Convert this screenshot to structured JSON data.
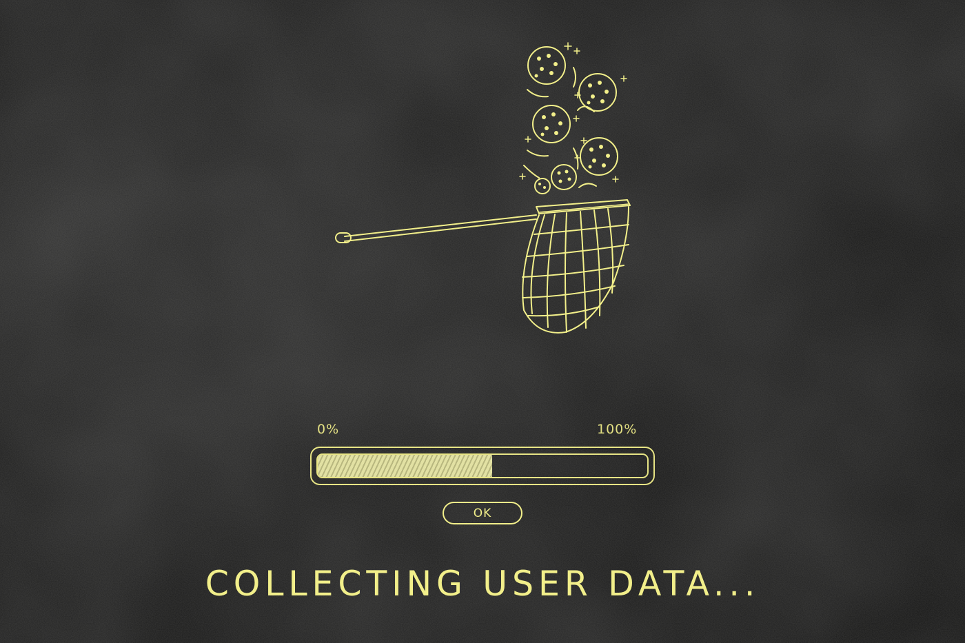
{
  "colors": {
    "ink": "#f2ef8a",
    "fill": "#ecebaa",
    "background": "#161616"
  },
  "illustration": {
    "icon": "butterfly-net-catching-cookies-icon",
    "cookie_count": 6
  },
  "progress": {
    "min_label": "0%",
    "max_label": "100%",
    "value_fraction": 0.53
  },
  "ok_button": {
    "label": "OK"
  },
  "caption": {
    "text": "COLLECTING USER DATA..."
  }
}
